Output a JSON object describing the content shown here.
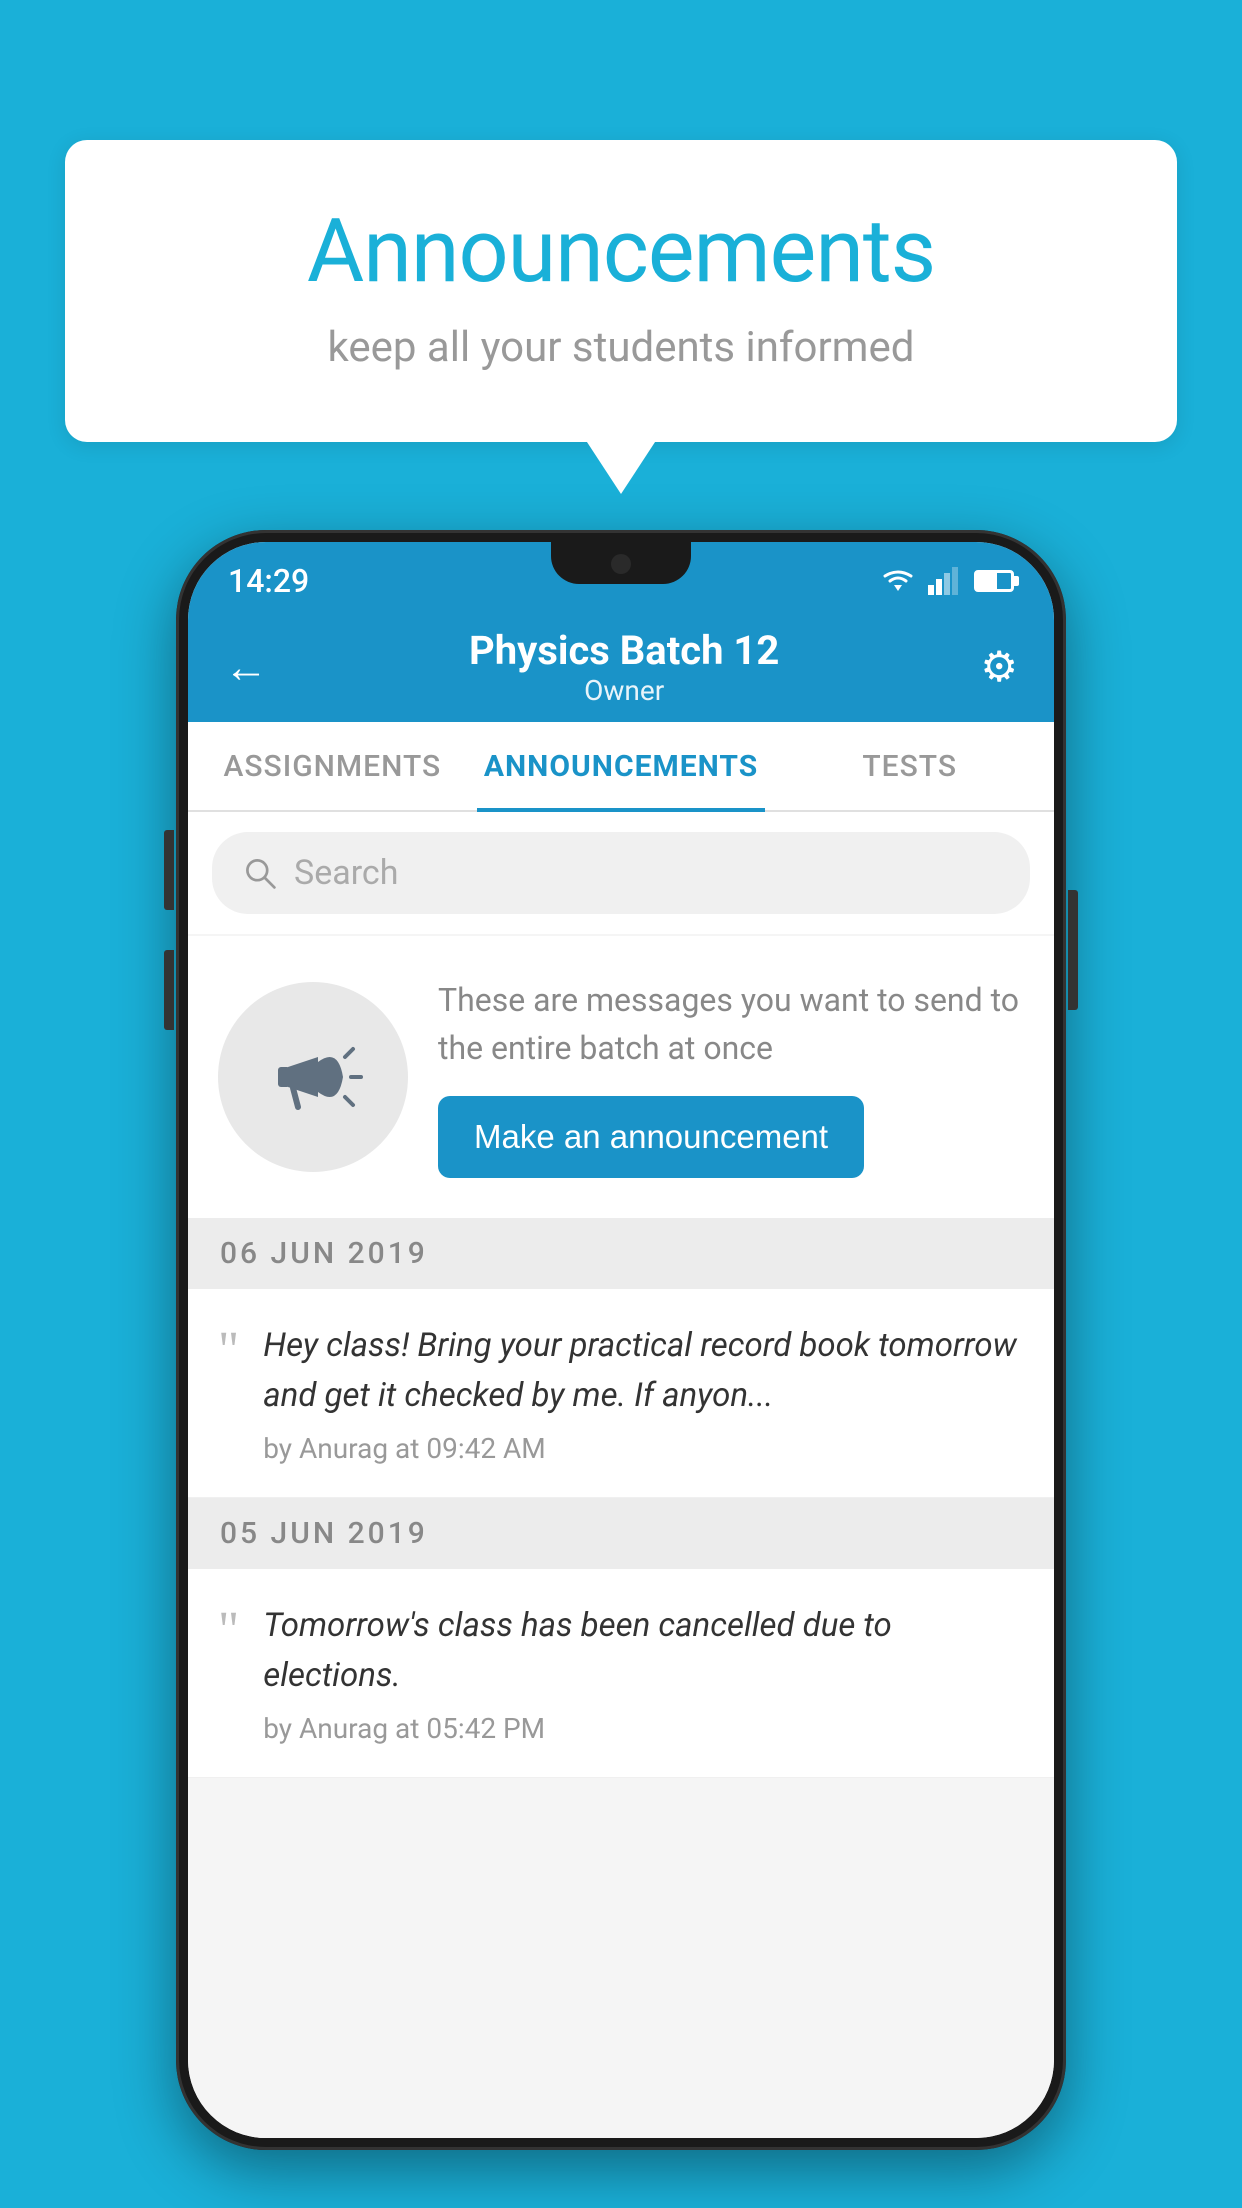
{
  "background": {
    "color": "#1ab0d8"
  },
  "speech_bubble": {
    "title": "Announcements",
    "subtitle": "keep all your students informed"
  },
  "phone": {
    "status_bar": {
      "time": "14:29"
    },
    "header": {
      "title": "Physics Batch 12",
      "subtitle": "Owner",
      "back_label": "←",
      "gear_label": "⚙"
    },
    "tabs": [
      {
        "id": "assignments",
        "label": "ASSIGNMENTS",
        "active": false
      },
      {
        "id": "announcements",
        "label": "ANNOUNCEMENTS",
        "active": true
      },
      {
        "id": "tests",
        "label": "TESTS",
        "active": false
      }
    ],
    "search": {
      "placeholder": "Search"
    },
    "promo": {
      "description": "These are messages you want to send to the entire batch at once",
      "button_label": "Make an announcement"
    },
    "announcements": [
      {
        "date": "06  JUN  2019",
        "text": "Hey class! Bring your practical record book tomorrow and get it checked by me. If anyon...",
        "meta": "by Anurag at 09:42 AM"
      },
      {
        "date": "05  JUN  2019",
        "text": "Tomorrow's class has been cancelled due to elections.",
        "meta": "by Anurag at 05:42 PM"
      }
    ]
  }
}
